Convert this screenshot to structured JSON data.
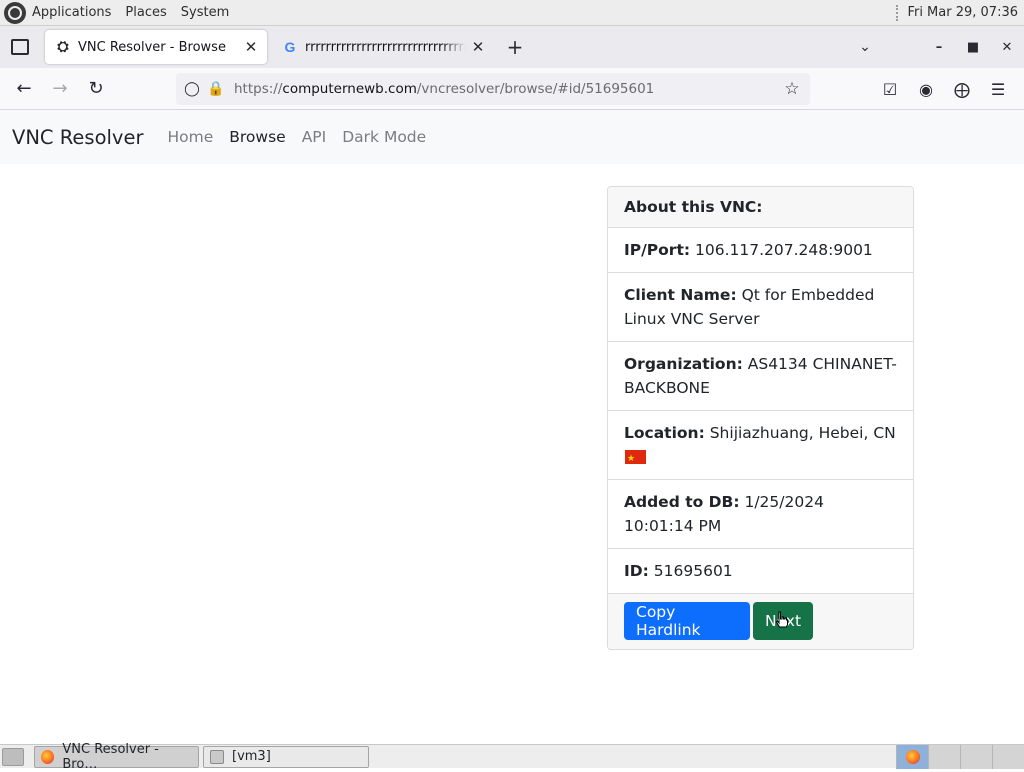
{
  "top_panel": {
    "menus": [
      "Applications",
      "Places",
      "System"
    ],
    "clock": "Fri Mar 29, 07:36"
  },
  "browser": {
    "tabs": [
      {
        "title": "VNC Resolver - Browse",
        "active": true
      },
      {
        "title": "rrrrrrrrrrrrrrrrrrrrrrrrrrrrrrrrrrrrrrrrr",
        "active": false
      }
    ],
    "tab_close_glyph": "✕",
    "newtab_glyph": "+",
    "url": {
      "protocol": "https://",
      "host": "computernewb.com",
      "path": "/vncresolver/browse/#id/51695601"
    }
  },
  "site": {
    "brand": "VNC Resolver",
    "nav": [
      "Home",
      "Browse",
      "API",
      "Dark Mode"
    ],
    "active_nav": "Browse"
  },
  "card": {
    "header": "About this VNC:",
    "rows": [
      {
        "label": "IP/Port:",
        "value": "106.117.207.248:9001"
      },
      {
        "label": "Client Name:",
        "value": "Qt for Embedded Linux VNC Server"
      },
      {
        "label": "Organization:",
        "value": "AS4134 CHINANET-BACKBONE"
      },
      {
        "label": "Location:",
        "value": "Shijiazhuang, Hebei, CN"
      },
      {
        "label": "Added to DB:",
        "value": "1/25/2024 10:01:14 PM"
      },
      {
        "label": "ID:",
        "value": "51695601"
      }
    ],
    "buttons": {
      "copy": "Copy Hardlink",
      "next": "Next"
    },
    "colors": {
      "copy": "#0d6efd",
      "next": "#157347"
    }
  },
  "taskbar": {
    "tasks": [
      {
        "label": "VNC Resolver - Bro…",
        "active": true
      },
      {
        "label": "[vm3]",
        "active": false
      }
    ]
  }
}
